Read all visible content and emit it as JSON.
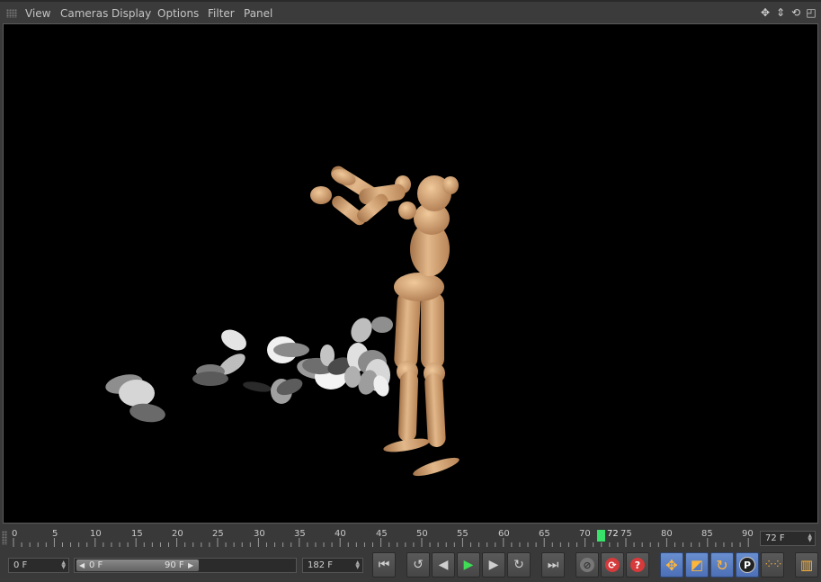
{
  "menubar": {
    "items": [
      "View",
      "Cameras",
      "Display",
      "Options",
      "Filter",
      "Panel"
    ]
  },
  "timeline": {
    "ticks": [
      "0",
      "5",
      "10",
      "15",
      "20",
      "25",
      "30",
      "35",
      "40",
      "45",
      "50",
      "55",
      "60",
      "65",
      "70",
      "75",
      "80",
      "85",
      "90"
    ],
    "playhead_frame_label": "72",
    "current_frame": "72 F"
  },
  "controls": {
    "start_frame": "0 F",
    "range_min": "0 F",
    "range_max": "90 F",
    "end_frame": "182 F"
  },
  "colors": {
    "playhead": "#39e36b",
    "tool_button": "#5b7fc4",
    "record_red": "#d63a3a",
    "play_green": "#3fdc55"
  }
}
